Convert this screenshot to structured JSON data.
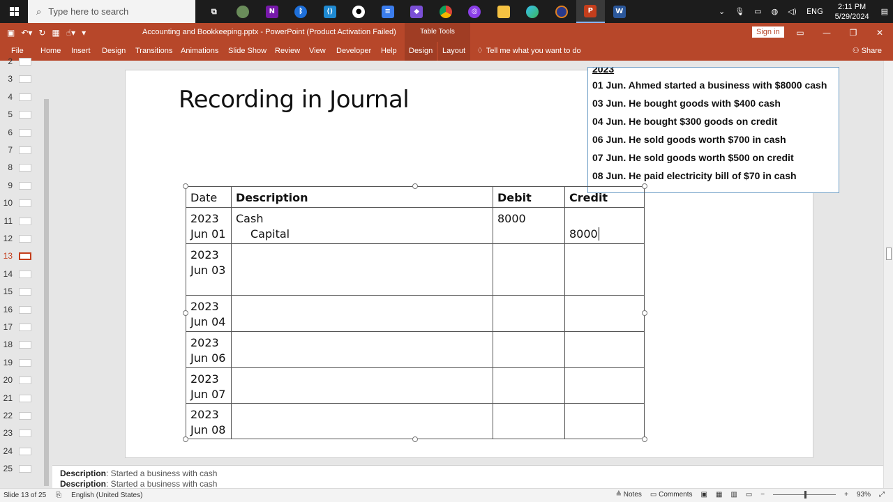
{
  "taskbar": {
    "search_placeholder": "Type here to search",
    "apps": [
      "task-view-icon",
      "copilot-icon",
      "onenote-icon",
      "bluetooth-icon",
      "vscode-icon",
      "github-icon",
      "google-docs-icon",
      "obsidian-icon",
      "chrome-icon",
      "app-icon",
      "file-explorer-icon",
      "edge-icon",
      "app-icon",
      "powerpoint-icon",
      "word-icon"
    ],
    "tray": {
      "language": "ENG",
      "time": "2:11 PM",
      "date": "5/29/2024"
    }
  },
  "titlebar": {
    "doc_title": "Accounting and Bookkeeping.pptx  -  PowerPoint (Product Activation Failed)",
    "context_group": "Table Tools",
    "sign_in": "Sign in"
  },
  "ribbon": {
    "tabs": [
      "File",
      "Home",
      "Insert",
      "Design",
      "Transitions",
      "Animations",
      "Slide Show",
      "Review",
      "View",
      "Developer",
      "Help"
    ],
    "context_tabs": [
      "Design",
      "Layout"
    ],
    "tell_me": "Tell me what you want to do",
    "share": "Share"
  },
  "thumbnails": {
    "numbers": [
      "2",
      "3",
      "4",
      "5",
      "6",
      "7",
      "8",
      "9",
      "10",
      "11",
      "12",
      "13",
      "14",
      "15",
      "16",
      "17",
      "18",
      "19",
      "20",
      "21",
      "22",
      "23",
      "24",
      "25"
    ],
    "current": "13"
  },
  "slide": {
    "title": "Recording in Journal",
    "transactions_year": "2023",
    "transactions": [
      "01 Jun. Ahmed started a business with $8000 cash",
      "03 Jun. He bought goods with $400 cash",
      "04 Jun. He bought $300 goods on credit",
      "06 Jun. He sold goods worth $700 in cash",
      "07 Jun. He sold goods worth $500 on credit",
      "08 Jun. He paid electricity bill of $70 in cash"
    ],
    "journal": {
      "headers": [
        "Date",
        "Description",
        "Debit",
        "Credit"
      ],
      "rows": [
        {
          "year": "2023",
          "day": "Jun 01",
          "debit_account": "Cash",
          "credit_account": "Capital",
          "debit": "8000",
          "credit": "8000"
        },
        {
          "year": "2023",
          "day": "Jun 03",
          "debit_account": "",
          "credit_account": "",
          "debit": "",
          "credit": ""
        },
        {
          "year": "2023",
          "day": "Jun 04",
          "debit_account": "",
          "credit_account": "",
          "debit": "",
          "credit": ""
        },
        {
          "year": "2023",
          "day": "Jun 06",
          "debit_account": "",
          "credit_account": "",
          "debit": "",
          "credit": ""
        },
        {
          "year": "2023",
          "day": "Jun 07",
          "debit_account": "",
          "credit_account": "",
          "debit": "",
          "credit": ""
        },
        {
          "year": "2023",
          "day": "Jun 08",
          "debit_account": "",
          "credit_account": "",
          "debit": "",
          "credit": ""
        }
      ]
    }
  },
  "notes": {
    "lines": [
      {
        "label": "Description",
        "text": ": Started a business with cash"
      },
      {
        "label": "Description",
        "text": ": Started a business with cash"
      }
    ]
  },
  "status": {
    "slide_info": "Slide 13 of 25",
    "language": "English (United States)",
    "notes": "Notes",
    "comments": "Comments",
    "zoom": "93%"
  }
}
